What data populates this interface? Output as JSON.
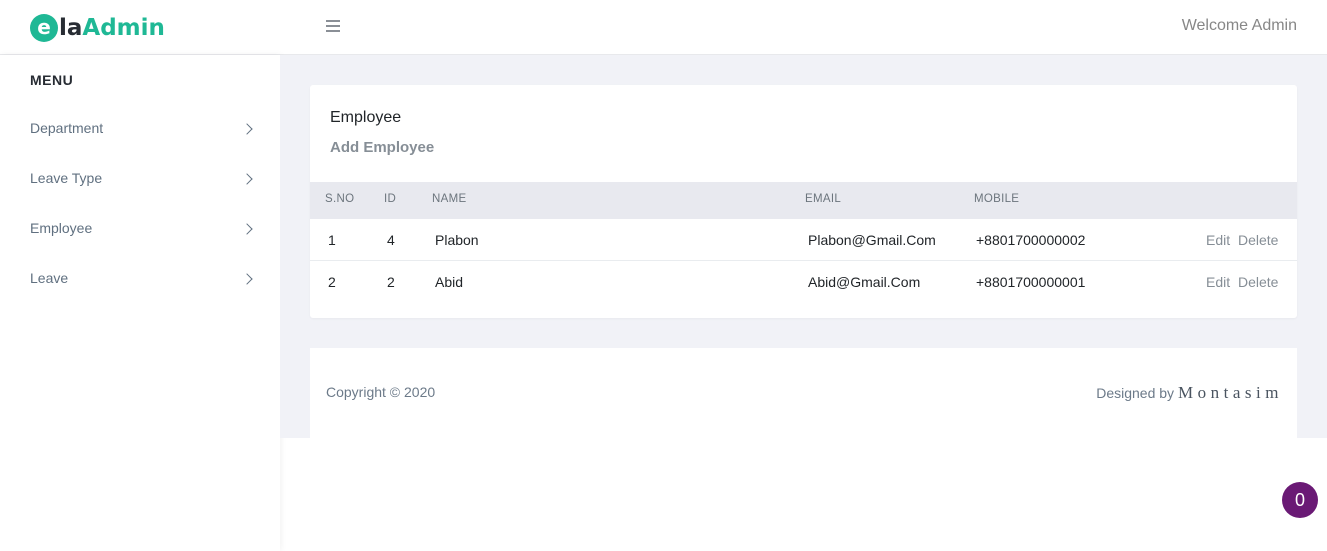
{
  "header": {
    "logo_letter": "e",
    "logo_la": "la",
    "logo_admin": "Admin",
    "welcome": "Welcome Admin",
    "menu_icon": "hamburger-icon"
  },
  "sidebar": {
    "title": "MENU",
    "items": [
      {
        "label": "Department"
      },
      {
        "label": "Leave Type"
      },
      {
        "label": "Employee"
      },
      {
        "label": "Leave"
      }
    ]
  },
  "main": {
    "card_title": "Employee",
    "add_link": "Add Employee",
    "table": {
      "headers": [
        "S.NO",
        "ID",
        "NAME",
        "EMAIL",
        "MOBILE"
      ],
      "rows": [
        {
          "sno": "1",
          "id": "4",
          "name": "Plabon",
          "email": "Plabon@Gmail.Com",
          "mobile": "+8801700000002",
          "edit": "Edit",
          "delete": "Delete"
        },
        {
          "sno": "2",
          "id": "2",
          "name": "Abid",
          "email": "Abid@Gmail.Com",
          "mobile": "+8801700000001",
          "edit": "Edit",
          "delete": "Delete"
        }
      ]
    }
  },
  "footer": {
    "copyright": "Copyright © 2020",
    "designed_by": "Designed by",
    "author": "Montasim"
  },
  "badge": {
    "count": "0"
  },
  "colors": {
    "brand": "#1fb895",
    "content_bg": "#f1f2f7",
    "badge": "#6a1a75"
  }
}
